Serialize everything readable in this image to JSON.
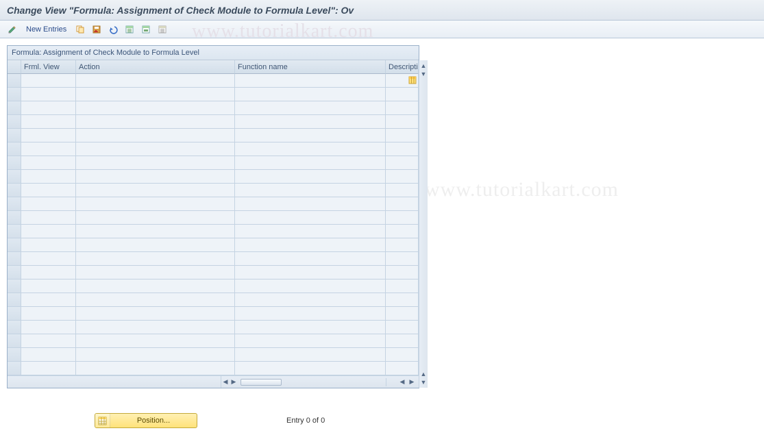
{
  "title": "Change View \"Formula: Assignment of Check Module to Formula Level\": Ov",
  "toolbar": {
    "new_entries": "New Entries"
  },
  "table": {
    "caption": "Formula: Assignment of Check Module to Formula Level",
    "columns": [
      "",
      "Frml. View",
      "Action",
      "Function name",
      "Description"
    ],
    "col4_visible": "Descripti",
    "row_count": 22,
    "rows": []
  },
  "footer": {
    "position_label": "Position...",
    "entry_label": "Entry 0 of 0"
  },
  "watermark": "www.tutorialkart.com",
  "icons": {
    "toggle_edit": "toggle-edit-pencil",
    "copy": "copy",
    "exit": "exit-disk",
    "undo": "undo",
    "select_all": "select-all-green",
    "select_block": "select-block-green",
    "deselect": "deselect",
    "table_settings": "table-settings",
    "position": "position-grid"
  },
  "colors": {
    "title_text": "#3b4b5d",
    "header_bg_top": "#eef2f6",
    "header_bg_bot": "#dfe6ee",
    "grid_line": "#c4d3e2",
    "grid_bg": "#eef3f8",
    "accent_yellow": "#ffe27a"
  }
}
